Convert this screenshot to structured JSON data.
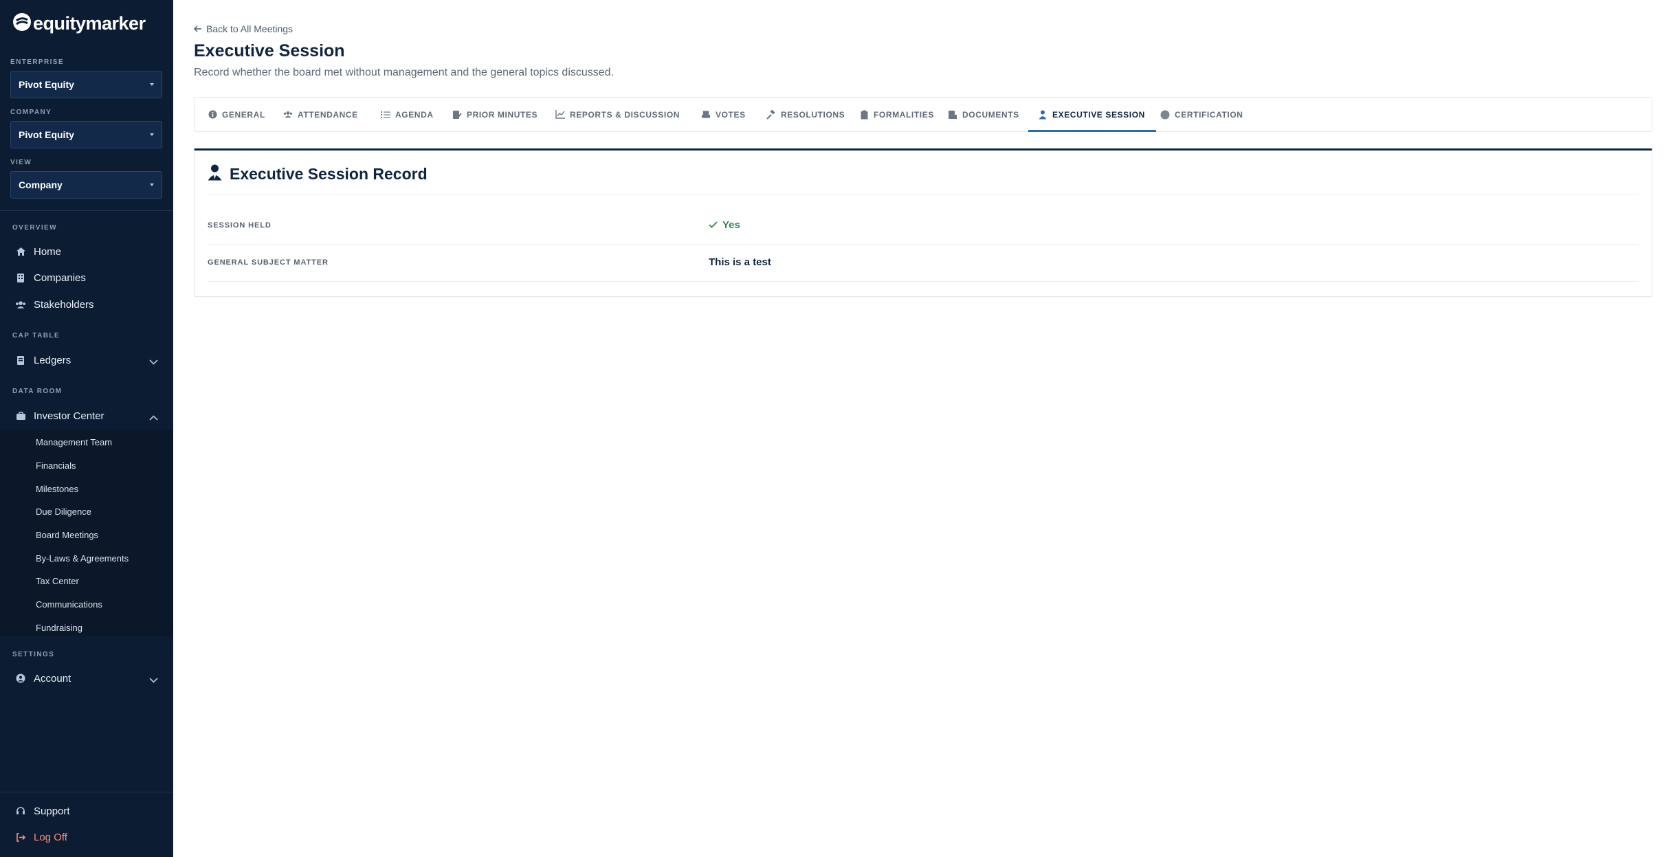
{
  "sidebar": {
    "logo_text": "equitymarker",
    "enterprise": {
      "label": "ENTERPRISE",
      "value": "Pivot Equity"
    },
    "company": {
      "label": "COMPANY",
      "value": "Pivot Equity"
    },
    "view": {
      "label": "VIEW",
      "value": "Company"
    },
    "groups": {
      "overview": "OVERVIEW",
      "cap_table": "CAP TABLE",
      "data_room": "DATA ROOM",
      "settings": "SETTINGS"
    },
    "nav": {
      "home": {
        "label": "Home",
        "icon": "home-icon"
      },
      "companies": {
        "label": "Companies",
        "icon": "building-icon"
      },
      "stakeholders": {
        "label": "Stakeholders",
        "icon": "users-icon"
      },
      "ledgers": {
        "label": "Ledgers",
        "icon": "book-icon"
      },
      "investor_center": {
        "label": "Investor Center",
        "icon": "briefcase-icon"
      },
      "account": {
        "label": "Account",
        "icon": "user-circle-icon"
      },
      "support": {
        "label": "Support",
        "icon": "headset-icon"
      },
      "logoff": {
        "label": "Log Off",
        "icon": "logout-icon"
      }
    },
    "investor_center_items": [
      "Management Team",
      "Financials",
      "Milestones",
      "Due Diligence",
      "Board Meetings",
      "By-Laws & Agreements",
      "Tax Center",
      "Communications",
      "Fundraising"
    ]
  },
  "header": {
    "back_label": "Back to All Meetings",
    "title": "Executive Session",
    "subtitle": "Record whether the board met without management and the general topics discussed."
  },
  "tabs": [
    {
      "label": "GENERAL",
      "icon": "info-icon"
    },
    {
      "label": "ATTENDANCE",
      "icon": "users-icon"
    },
    {
      "label": "AGENDA",
      "icon": "list-icon"
    },
    {
      "label": "PRIOR MINUTES",
      "icon": "file-edit-icon"
    },
    {
      "label": "REPORTS & DISCUSSION",
      "icon": "chart-line-icon"
    },
    {
      "label": "VOTES",
      "icon": "ballot-icon"
    },
    {
      "label": "RESOLUTIONS",
      "icon": "gavel-icon"
    },
    {
      "label": "FORMALITIES",
      "icon": "clipboard-icon"
    },
    {
      "label": "DOCUMENTS",
      "icon": "documents-icon"
    },
    {
      "label": "EXECUTIVE SESSION",
      "icon": "user-tie-icon",
      "active": true
    },
    {
      "label": "CERTIFICATION",
      "icon": "seal-icon"
    }
  ],
  "card": {
    "title": "Executive Session Record",
    "rows": [
      {
        "label": "SESSION HELD",
        "value": "Yes"
      },
      {
        "label": "GENERAL SUBJECT MATTER",
        "value": "This is a test"
      }
    ]
  },
  "colors": {
    "sidebar_bg": "#0c1d33",
    "accent": "#2b6cb0",
    "navy": "#0f2540",
    "success": "#2f8a4a",
    "logoff": "#ff8a7a"
  }
}
